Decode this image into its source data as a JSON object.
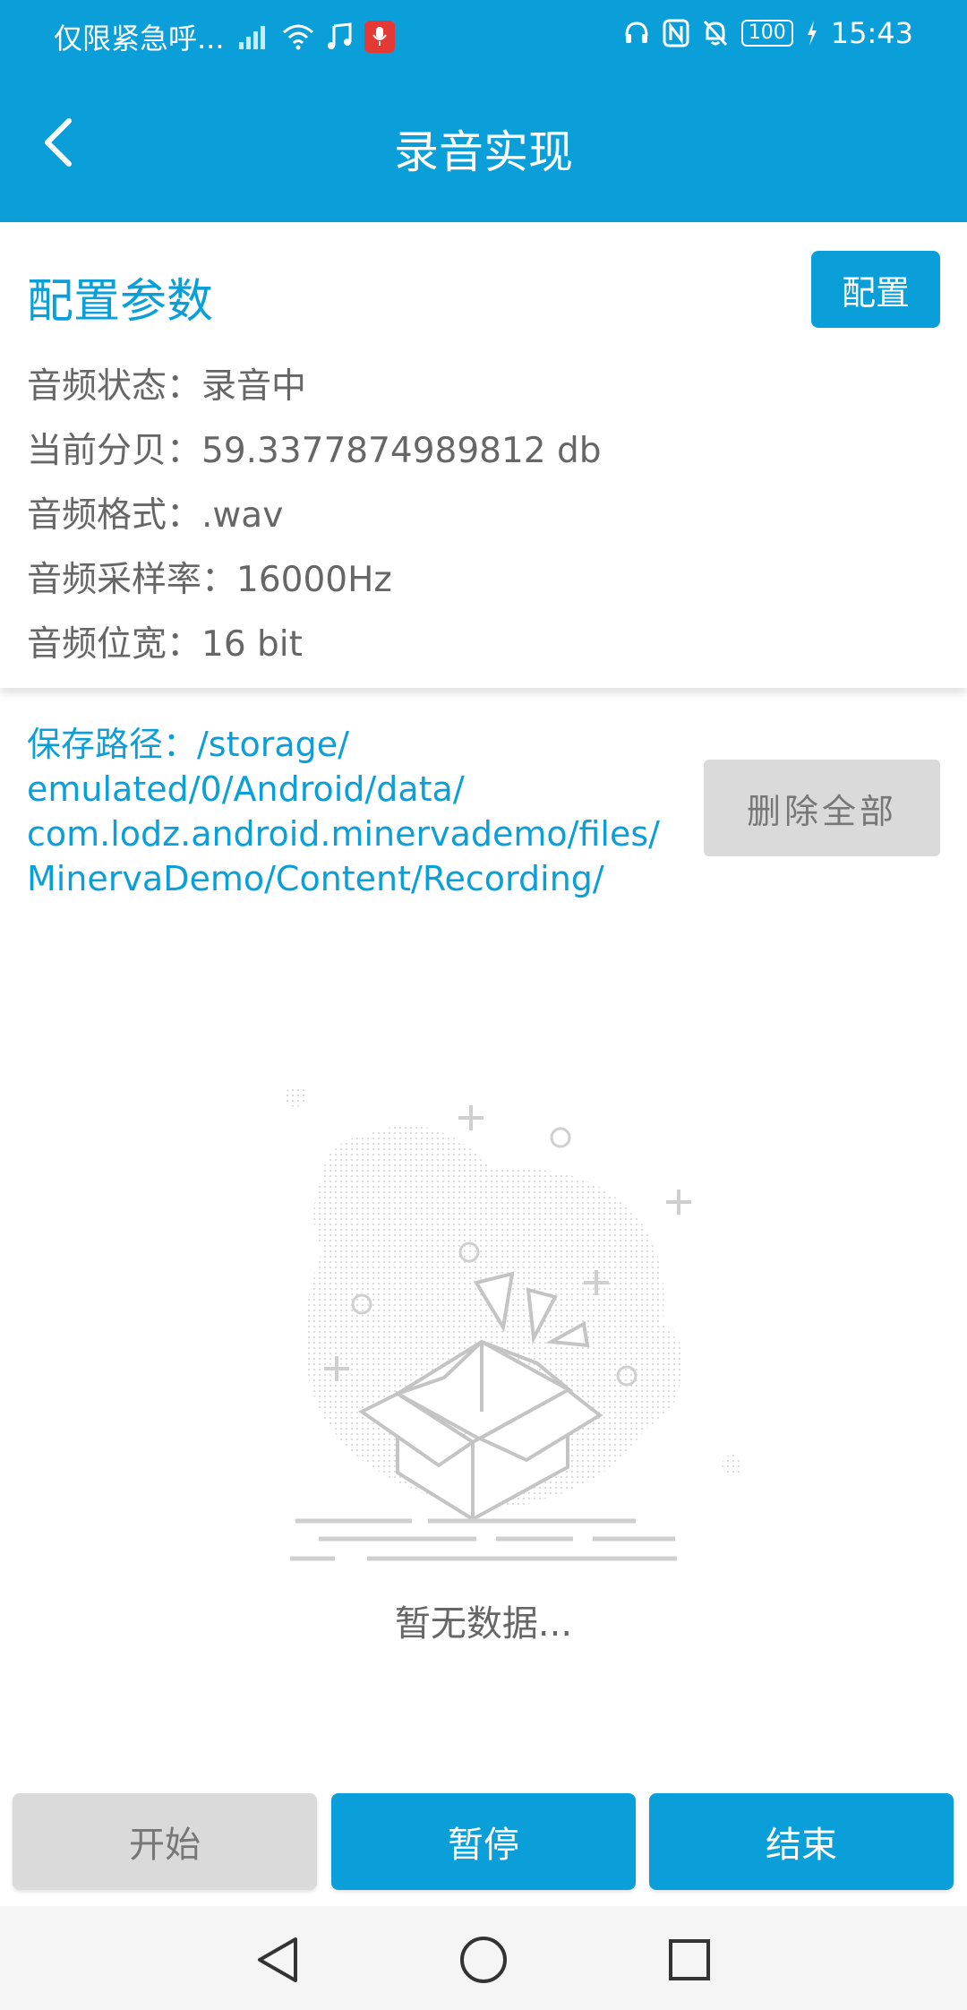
{
  "status_bar": {
    "carrier": "仅限紧急呼...",
    "time": "15:43",
    "battery": "100"
  },
  "toolbar": {
    "title": "录音实现"
  },
  "config": {
    "title": "配置参数",
    "button_label": "配置",
    "rows": [
      "音频状态：录音中",
      "当前分贝：59.3377874989812 db",
      "音频格式：.wav",
      "音频采样率：16000Hz",
      "音频位宽：16 bit"
    ]
  },
  "path": {
    "lines": [
      "保存路径：/storage/",
      "emulated/0/Android/data/",
      "com.lodz.android.minervademo/files/",
      "MinervaDemo/Content/Recording/"
    ],
    "delete_all_label": "删除全部"
  },
  "empty": {
    "text": "暂无数据..."
  },
  "actions": {
    "start_label": "开始",
    "pause_label": "暂停",
    "stop_label": "结束"
  },
  "colors": {
    "primary": "#0A9FD8",
    "disabled": "#DADADA"
  }
}
